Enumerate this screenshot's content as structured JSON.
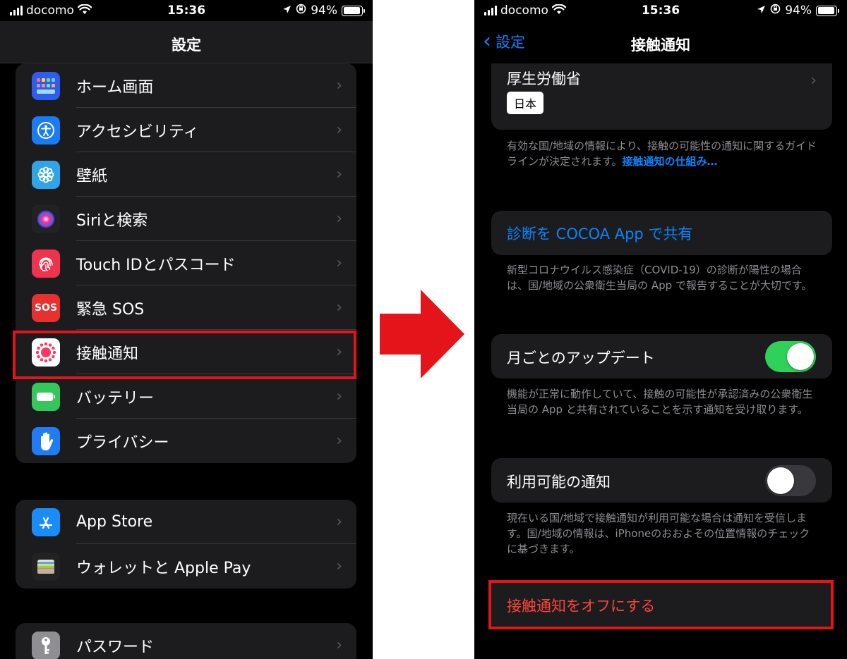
{
  "status": {
    "carrier": "docomo",
    "time": "15:36",
    "battery": "94%",
    "battery_level": 0.94
  },
  "left": {
    "nav_title": "設定",
    "groups": [
      [
        {
          "label": "ホーム画面",
          "icon": "home-screen-icon",
          "color": "#2c5cf0"
        },
        {
          "label": "アクセシビリティ",
          "icon": "accessibility-icon",
          "color": "#1a7cf5"
        },
        {
          "label": "壁紙",
          "icon": "wallpaper-icon",
          "color": "#2fa4e7"
        },
        {
          "label": "Siriと検索",
          "icon": "siri-icon",
          "color": "#222222"
        },
        {
          "label": "Touch IDとパスコード",
          "icon": "fingerprint-icon",
          "color": "#f0334d"
        },
        {
          "label": "緊急 SOS",
          "icon": "sos-icon",
          "icon_text": "SOS",
          "color": "#e8302f"
        },
        {
          "label": "接触通知",
          "icon": "exposure-notification-icon",
          "color": "#ffffff"
        },
        {
          "label": "バッテリー",
          "icon": "battery-icon",
          "color": "#34c759"
        },
        {
          "label": "プライバシー",
          "icon": "privacy-hand-icon",
          "color": "#1f7cf5"
        }
      ],
      [
        {
          "label": "App Store",
          "icon": "app-store-icon",
          "color": "#1a8cf8"
        },
        {
          "label": "ウォレットと Apple Pay",
          "icon": "wallet-icon",
          "color": "#222222"
        }
      ],
      [
        {
          "label": "パスワード",
          "icon": "key-icon",
          "color": "#8e8e93"
        }
      ]
    ]
  },
  "right": {
    "back_label": "設定",
    "nav_title": "接触通知",
    "authority": {
      "name": "厚生労働省",
      "region": "日本"
    },
    "authority_note": "有効な国/地域の情報により、接触の可能性の通知に関するガイドラインが決定されます。",
    "authority_link": "接触通知の仕組み…",
    "share_label": "診断を COCOA App で共有",
    "share_note": "新型コロナウイルス感染症（COVID-19）の診断が陽性の場合は、国/地域の公衆衛生当局の App で報告することが大切です。",
    "monthly_update": {
      "label": "月ごとのアップデート",
      "on": true,
      "note": "機能が正常に動作していて、接触の可能性が承認済みの公衆衛生当局の App と共有されていることを示す通知を受け取ります。"
    },
    "availability": {
      "label": "利用可能の通知",
      "on": false,
      "note": "現在いる国/地域で接触通知が利用可能な場合は通知を受信します。国/地域の情報は、iPhoneのおおよその位置情報のチェックに基づきます。"
    },
    "turn_off_label": "接触通知をオフにする"
  },
  "colors": {
    "toggle_on": "#30d158",
    "toggle_off": "#39393d",
    "highlight": "#e5141b",
    "arrow": "#e5141b"
  }
}
